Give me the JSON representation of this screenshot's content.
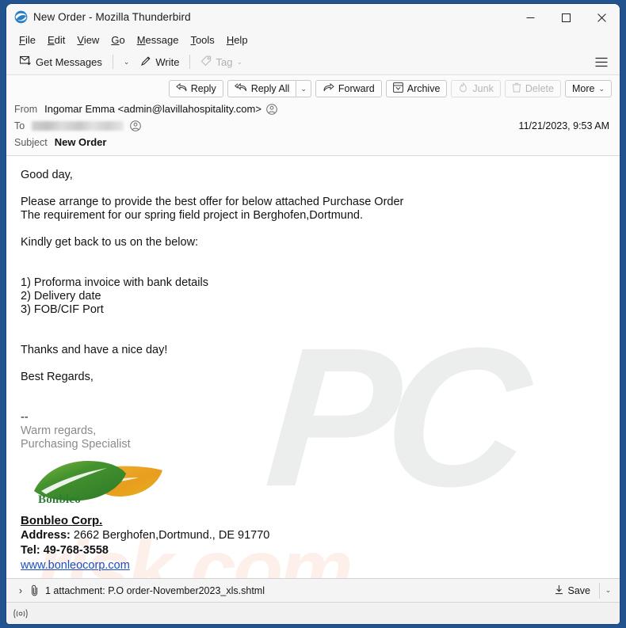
{
  "window": {
    "title": "New Order - Mozilla Thunderbird",
    "app_icon": "thunderbird-icon",
    "controls": {
      "minimize": "–",
      "maximize": "□",
      "close": "✕"
    }
  },
  "menubar": {
    "items": [
      {
        "label": "File",
        "accesskey": "F"
      },
      {
        "label": "Edit",
        "accesskey": "E"
      },
      {
        "label": "View",
        "accesskey": "V"
      },
      {
        "label": "Go",
        "accesskey": "G"
      },
      {
        "label": "Message",
        "accesskey": "M"
      },
      {
        "label": "Tools",
        "accesskey": "T"
      },
      {
        "label": "Help",
        "accesskey": "H"
      }
    ]
  },
  "toolbar": {
    "get_messages": "Get Messages",
    "get_messages_caret": "⌄",
    "write": "Write",
    "tag": "Tag",
    "tag_caret": "⌄",
    "tag_disabled": true,
    "hamburger": "☰"
  },
  "message_actions": {
    "reply": "Reply",
    "reply_all": "Reply All",
    "reply_all_caret": "⌄",
    "forward": "Forward",
    "archive": "Archive",
    "junk": "Junk",
    "junk_disabled": true,
    "delete": "Delete",
    "delete_disabled": true,
    "more": "More",
    "more_caret": "⌄"
  },
  "headers": {
    "from_label": "From",
    "from_value": "Ingomar Emma <admin@lavillahospitality.com>",
    "to_label": "To",
    "to_value": "",
    "to_redacted": true,
    "subject_label": "Subject",
    "subject_value": "New Order",
    "date": "11/21/2023, 9:53 AM"
  },
  "body": {
    "lines": [
      "Good day,",
      "",
      "Please arrange to provide the best offer for below attached Purchase Order",
      "The requirement for our spring field project in Berghofen,Dortmund.",
      "",
      "Kindly get back to us on the below:",
      "",
      "",
      "1) Proforma invoice with bank details",
      "2) Delivery date",
      "3) FOB/CIF Port",
      "",
      "",
      "Thanks and have a nice day!",
      "",
      "Best Regards,",
      "",
      ""
    ],
    "signature_separator": "--",
    "signature_lines": [
      "Warm regards,",
      "Purchasing Specialist"
    ]
  },
  "signature_block": {
    "logo_text": "Bonbleo",
    "company_name": "Bonbleo Corp.",
    "address_label": "Address:",
    "address_value": "2662  Berghofen,Dortmund., DE 91770",
    "tel_label": "Tel:",
    "tel_value": "49-768-3558",
    "website": "www.bonleocorp.com"
  },
  "attachment": {
    "expand_icon": "›",
    "clip_icon": "paperclip-icon",
    "text": "1 attachment: P.O order-November2023_xls.shtml",
    "save_label": "Save",
    "save_caret": "⌄"
  },
  "statusbar": {
    "online_icon": "((o))"
  },
  "watermark": {
    "primary": "PC",
    "secondary": "risk.com"
  },
  "colors": {
    "desktop_blue": "#23538f",
    "chrome_gray": "#f7f7f7",
    "link_blue": "#1a4fbf",
    "leaf_green": "#3f8f30",
    "leaf_orange": "#eaa52a",
    "watermark_gray": "#eceded",
    "watermark_peach": "#fdf0ea"
  }
}
